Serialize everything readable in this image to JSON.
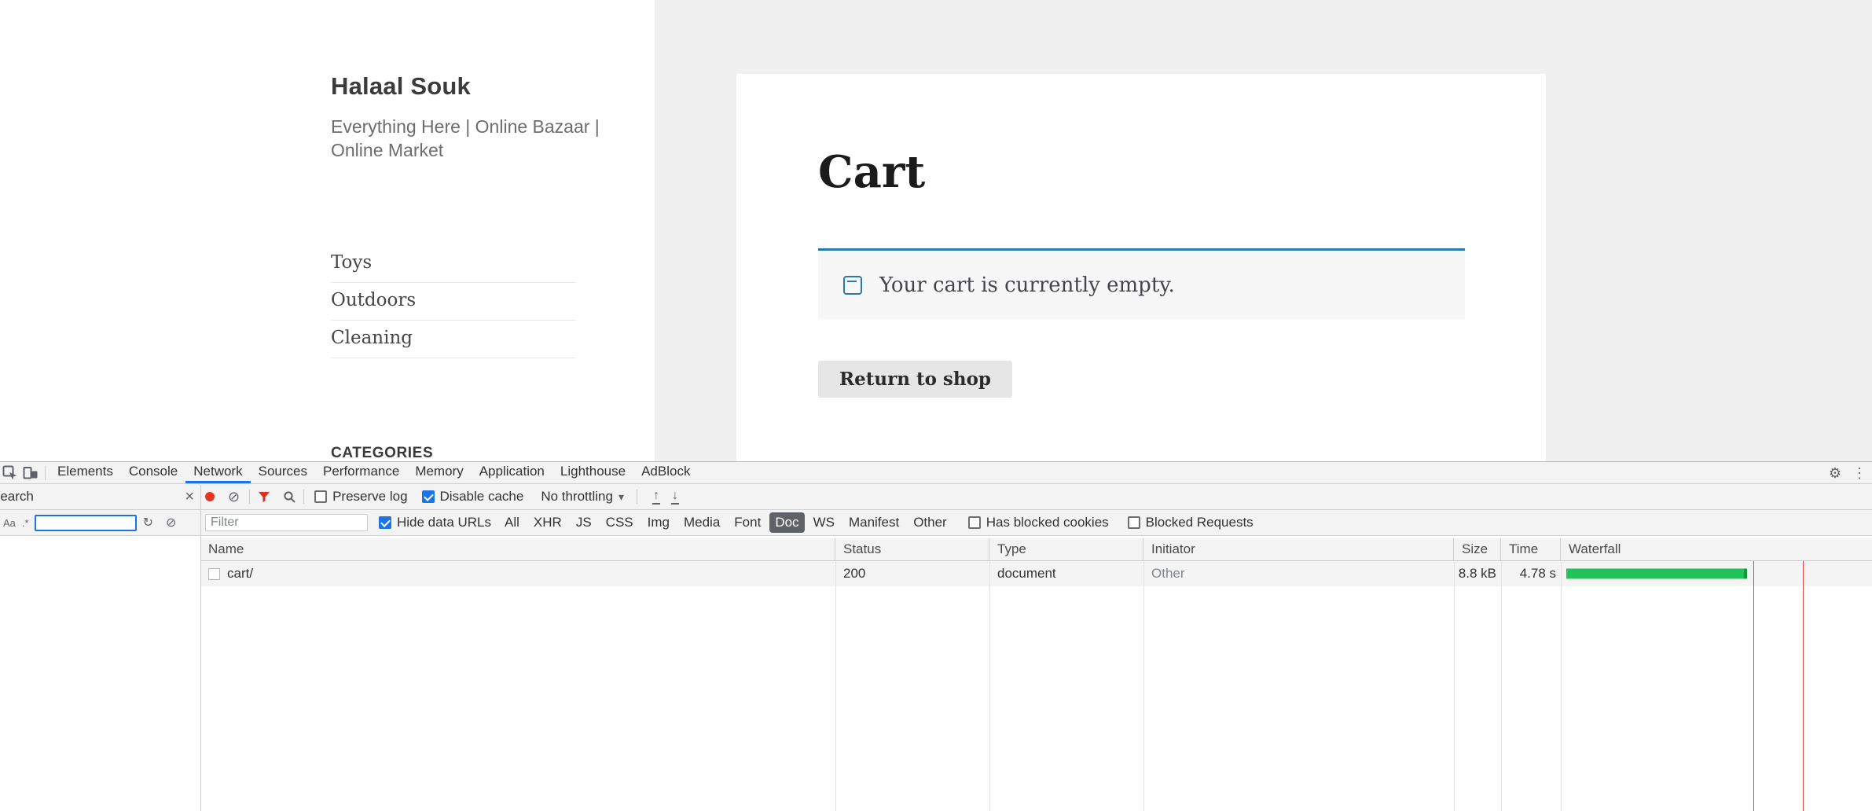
{
  "site": {
    "title": "Halaal Souk",
    "tagline": "Everything Here | Online Bazaar | Online Market",
    "menu": [
      {
        "label": "Toys"
      },
      {
        "label": "Outdoors"
      },
      {
        "label": "Cleaning"
      }
    ],
    "categories_heading": "CATEGORIES"
  },
  "cart": {
    "title": "Cart",
    "empty_message": "Your cart is currently empty.",
    "return_button": "Return to shop"
  },
  "devtools": {
    "tabs": [
      "Elements",
      "Console",
      "Network",
      "Sources",
      "Performance",
      "Memory",
      "Application",
      "Lighthouse",
      "AdBlock"
    ],
    "active_tab": "Network",
    "search_panel": {
      "tab_label": "Search",
      "search_value": ""
    },
    "toolbar": {
      "preserve_log": "Preserve log",
      "disable_cache": "Disable cache",
      "throttling": "No throttling"
    },
    "filter_bar": {
      "placeholder": "Filter",
      "hide_data_urls": "Hide data URLs",
      "pills": [
        "All",
        "XHR",
        "JS",
        "CSS",
        "Img",
        "Media",
        "Font",
        "Doc",
        "WS",
        "Manifest",
        "Other"
      ],
      "selected_pill": "Doc",
      "has_blocked_cookies": "Has blocked cookies",
      "blocked_requests": "Blocked Requests"
    },
    "table": {
      "columns": [
        "Name",
        "Status",
        "Type",
        "Initiator",
        "Size",
        "Time",
        "Waterfall"
      ],
      "rows": [
        {
          "name": "cart/",
          "status": "200",
          "type": "document",
          "initiator": "Other",
          "size": "8.8 kB",
          "time": "4.78 s"
        }
      ]
    }
  },
  "icons": {
    "gear": "⚙",
    "more": "⋮",
    "close": "×",
    "refresh": "↻",
    "block": "⊘",
    "caret": "▾",
    "up_arrow": "↑",
    "down_arrow": "↓",
    "match_case": "Aa",
    "regex": ".*"
  },
  "colors": {
    "accent_blue": "#1a73e8",
    "record_red": "#ea3323",
    "filter_red": "#d93025",
    "waterfall_green": "#21c25a",
    "event_blue": "#3b7dd8",
    "event_red": "#d04a43",
    "notice_blue": "#2779ae"
  }
}
